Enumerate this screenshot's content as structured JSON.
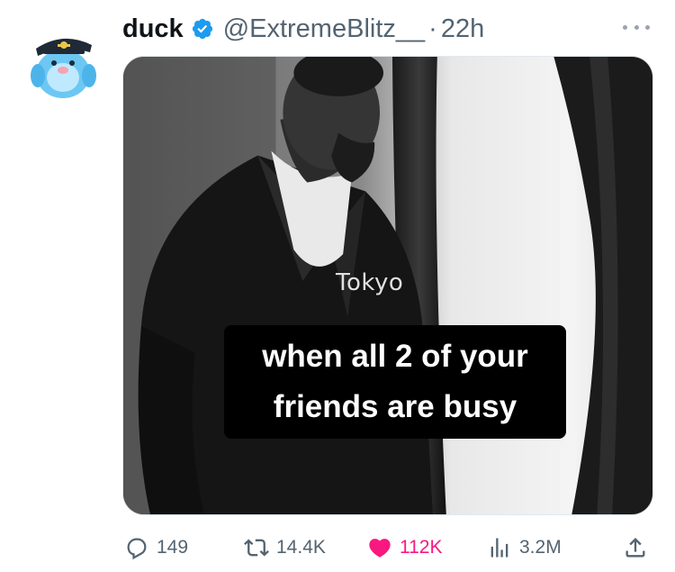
{
  "tweet": {
    "author": {
      "display_name": "duck",
      "handle": "@ExtremeBlitz__",
      "separator": "·",
      "time": "22h",
      "verified": true,
      "avatar_icon": "blue-cartoon-bird-avatar"
    },
    "more_icon": "ellipsis-icon",
    "media": {
      "watermark": "Tokyo",
      "caption": "when all 2 of your friends are busy"
    },
    "actions": {
      "replies": {
        "icon": "reply-icon",
        "count": "149"
      },
      "retweets": {
        "icon": "retweet-icon",
        "count": "14.4K"
      },
      "likes": {
        "icon": "heart-icon",
        "count": "112K",
        "liked": true
      },
      "views": {
        "icon": "views-chart-icon",
        "count": "3.2M"
      },
      "share": {
        "icon": "share-icon"
      }
    }
  },
  "colors": {
    "text": "#0f1419",
    "muted": "#536471",
    "verified": "#1d9bf0",
    "like": "#f91880"
  }
}
